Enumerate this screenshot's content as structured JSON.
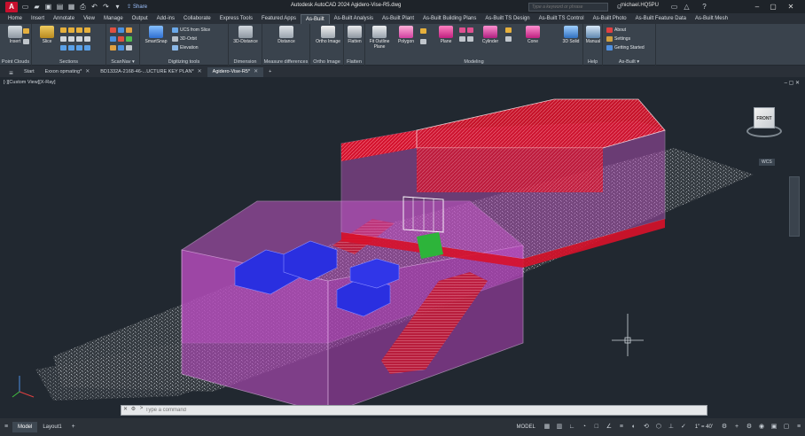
{
  "titlebar": {
    "logo": "A",
    "share_label": "Share",
    "title": "Autodesk AutoCAD 2024   Agidero-Vise-R5.dwg",
    "search_placeholder": "Type a keyword or phrase",
    "user_name": "michael.HQ5PU"
  },
  "ribbon_tabs": [
    "Home",
    "Insert",
    "Annotate",
    "View",
    "Manage",
    "Output",
    "Add-ins",
    "Collaborate",
    "Express Tools",
    "Featured Apps",
    "As-Built",
    "As-Built Analysis",
    "As-Built Plant",
    "As-Built Building Plans",
    "As-Built TS Design",
    "As-Built TS Control",
    "As-Built Photo",
    "As-Built Feature Data",
    "As-Built Mesh"
  ],
  "active_ribbon_tab": "As-Built",
  "ribbon": {
    "insert": "Insert",
    "slice": "Slice",
    "smartsnap": "SmartSnap",
    "ucs_from_slice": "UCS from Slice",
    "orbit_3d": "3D-Orbit",
    "elevation": "Elevation",
    "distance_3d": "3D-Distance",
    "distance": "Distance",
    "ortho_image": "Ortho Image",
    "flatten": "Flatten",
    "fit_outline_plane": "Fit Outline Plane",
    "polygon": "Polygon",
    "plane": "Plane",
    "cylinder": "Cylinder",
    "cone": "Cone",
    "solid_3d": "3D Solid",
    "manual": "Manual",
    "about": "About",
    "settings": "Settings",
    "getting_started": "Getting Started",
    "panels": {
      "point_clouds": "Point Clouds",
      "sections": "Sections",
      "scannav": "ScanNav ▾",
      "digitizing_tools": "Digitizing tools",
      "dimension": "Dimension",
      "measure_differences": "Measure differences",
      "ortho_image": "Ortho Image",
      "flatten": "Flatten",
      "modeling": "Modeling",
      "help": "Help",
      "as_built": "As-Built ▾"
    }
  },
  "doc_tabs": [
    {
      "label": "Start",
      "active": false
    },
    {
      "label": "Exxon opmating*",
      "active": false
    },
    {
      "label": "BD1332A-2168-46-...UCTURE KEY PLAN*",
      "active": false
    },
    {
      "label": "Agidero-Vise-R5*",
      "active": true
    }
  ],
  "viewport": {
    "label": "[-][Custom View][X-Ray]",
    "viewcube_face": "FRONT",
    "wcs": "WCS"
  },
  "command_line": {
    "placeholder": "Type a command"
  },
  "statusbar": {
    "tabs": [
      "Model",
      "Layout1"
    ],
    "active_tab": "Model",
    "model_label": "MODEL",
    "scale": "1\" = 40'"
  },
  "colors": {
    "roof_red": "#d8112a",
    "facade_magenta": "#c456c8",
    "equipment_blue": "#2a2fe0",
    "pointcloud_grey": "#8a8f94",
    "accent_green": "#2db43a",
    "background": "#212830"
  }
}
